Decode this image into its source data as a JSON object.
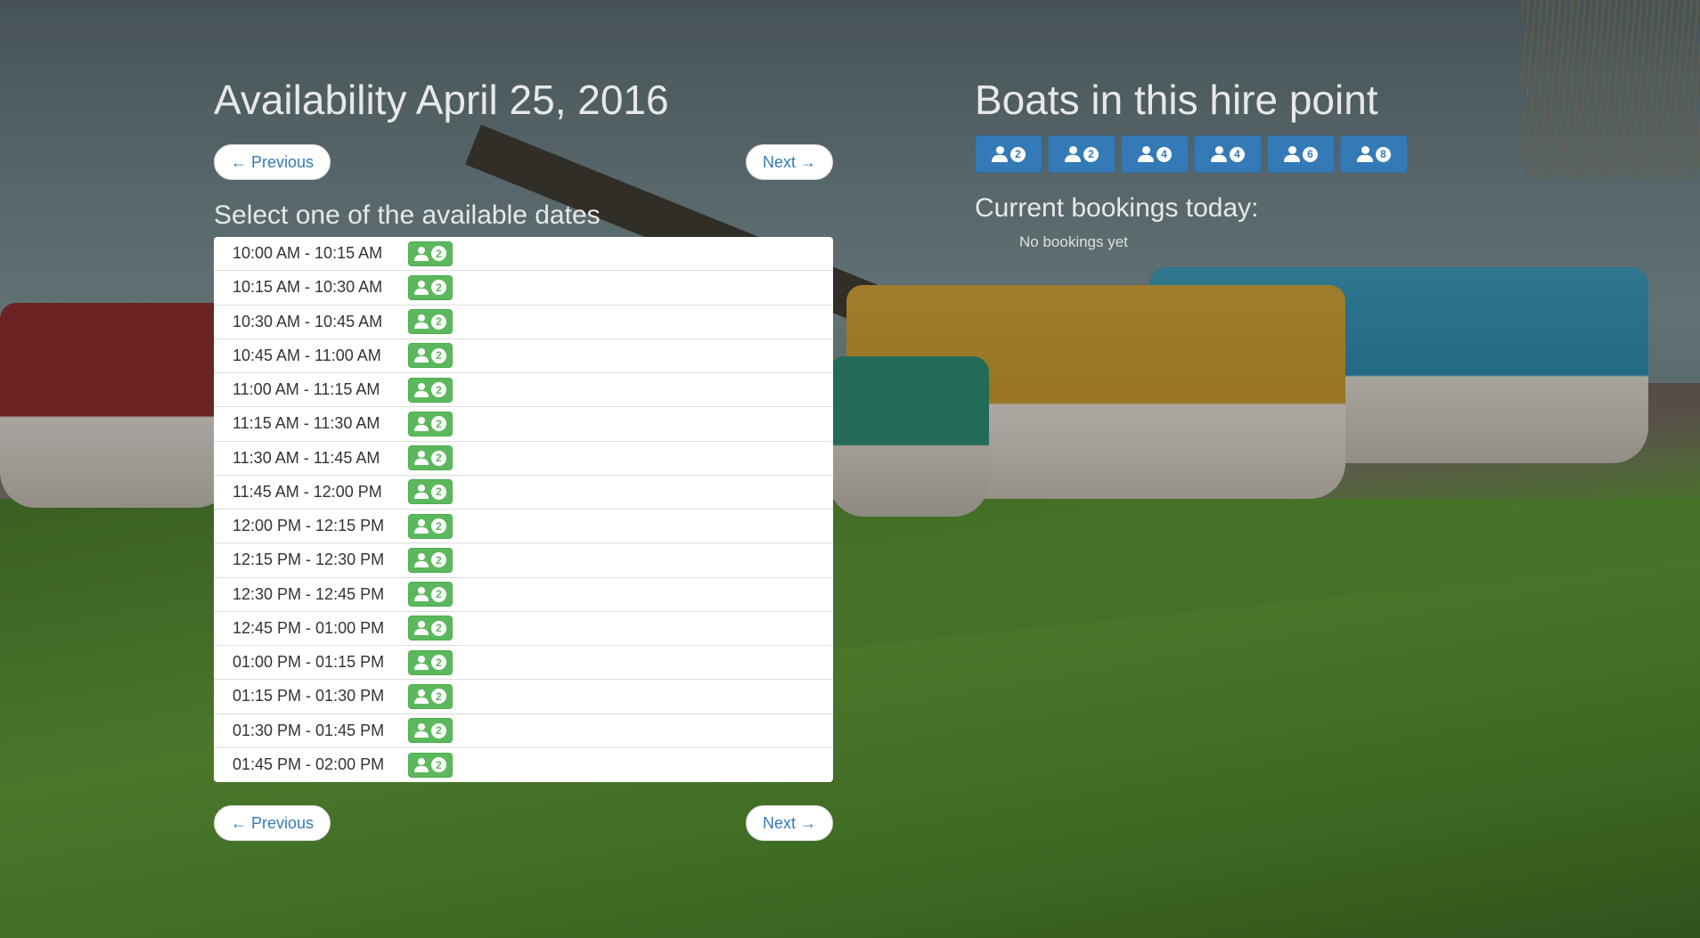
{
  "availability": {
    "title": "Availability April 25, 2016",
    "prev_label": "← Previous",
    "next_label": "Next →",
    "subtitle": "Select one of the available dates",
    "slots": [
      {
        "time": "10:00 AM - 10:15 AM",
        "capacity": "2"
      },
      {
        "time": "10:15 AM - 10:30 AM",
        "capacity": "2"
      },
      {
        "time": "10:30 AM - 10:45 AM",
        "capacity": "2"
      },
      {
        "time": "10:45 AM - 11:00 AM",
        "capacity": "2"
      },
      {
        "time": "11:00 AM - 11:15 AM",
        "capacity": "2"
      },
      {
        "time": "11:15 AM - 11:30 AM",
        "capacity": "2"
      },
      {
        "time": "11:30 AM - 11:45 AM",
        "capacity": "2"
      },
      {
        "time": "11:45 AM - 12:00 PM",
        "capacity": "2"
      },
      {
        "time": "12:00 PM - 12:15 PM",
        "capacity": "2"
      },
      {
        "time": "12:15 PM - 12:30 PM",
        "capacity": "2"
      },
      {
        "time": "12:30 PM - 12:45 PM",
        "capacity": "2"
      },
      {
        "time": "12:45 PM - 01:00 PM",
        "capacity": "2"
      },
      {
        "time": "01:00 PM - 01:15 PM",
        "capacity": "2"
      },
      {
        "time": "01:15 PM - 01:30 PM",
        "capacity": "2"
      },
      {
        "time": "01:30 PM - 01:45 PM",
        "capacity": "2"
      },
      {
        "time": "01:45 PM - 02:00 PM",
        "capacity": "2"
      }
    ]
  },
  "hire_point": {
    "title": "Boats in this hire point",
    "boats": [
      "2",
      "2",
      "4",
      "4",
      "6",
      "8"
    ],
    "bookings_title": "Current bookings today:",
    "no_bookings": "No bookings yet"
  },
  "colors": {
    "slot_badge": "#5cb85c",
    "boat_button": "#337ab7",
    "link": "#337ab7"
  },
  "icons": {
    "slot_badge": "user-icon",
    "boat_button": "user-icon"
  }
}
